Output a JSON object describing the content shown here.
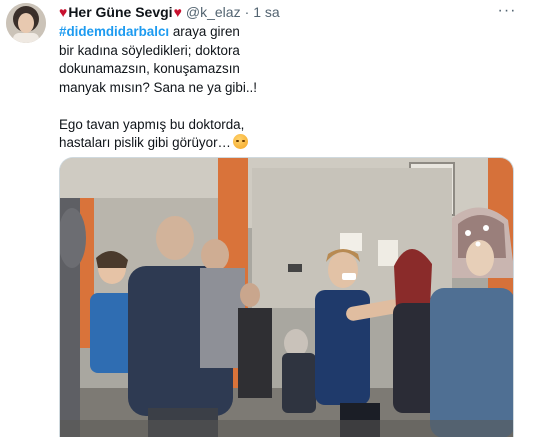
{
  "tweet": {
    "author": {
      "display_name": "Her Güne Sevgi",
      "handle": "@k_elaz",
      "separator": "·",
      "time": "1 sa",
      "name_prefix_emoji": "heart-icon",
      "name_suffix_emoji": "heart-icon"
    },
    "hashtag": "#didemdidarbalcı",
    "line1_rest": " araya giren",
    "line2": "bir kadına söyledikleri; doktora",
    "line3": "dokunamazsın, konuşamazsın",
    "line4": "manyak mısın? Sana ne ya gibi..!",
    "line5": "Ego tavan yapmış bu doktorda,",
    "line6": "hastaları pislik gibi görüyor…",
    "more_label": "···",
    "emoji": "disappointed-face-icon"
  },
  "colors": {
    "hashtag": "#1d9bf0",
    "heart": "#c8102e",
    "secondary_text": "#536471",
    "border": "#cfd9de"
  }
}
